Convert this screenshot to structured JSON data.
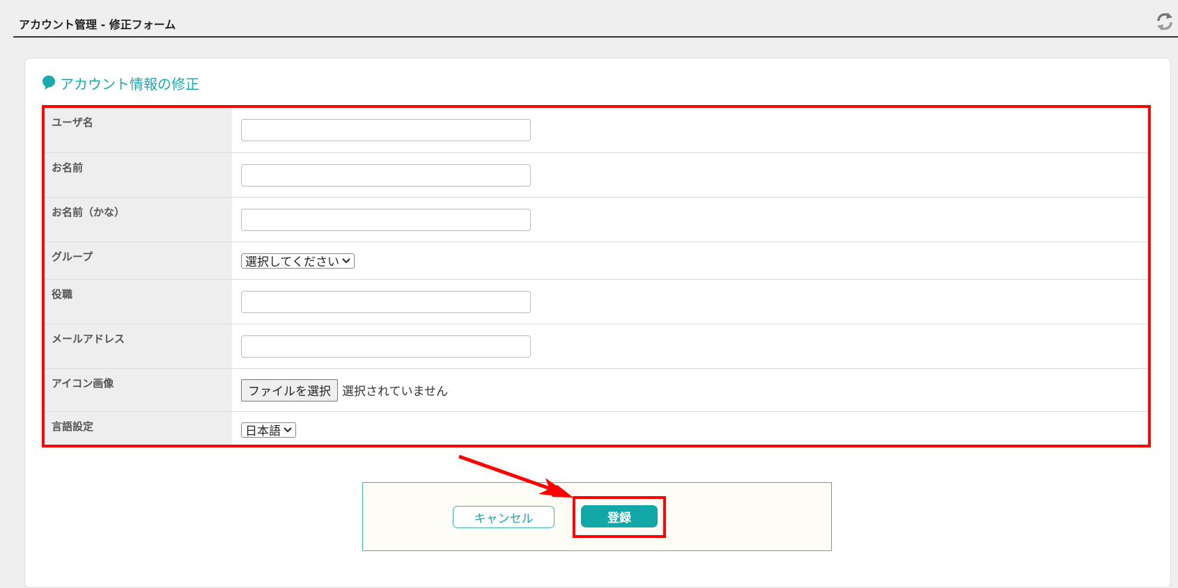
{
  "header": {
    "title": "アカウント管理 - 修正フォーム",
    "refresh_icon": "refresh-icon"
  },
  "section": {
    "title": "アカウント情報の修正"
  },
  "form": {
    "rows": [
      {
        "label": "ユーザ名",
        "type": "text",
        "value": ""
      },
      {
        "label": "お名前",
        "type": "text",
        "value": ""
      },
      {
        "label": "お名前（かな）",
        "type": "text",
        "value": ""
      },
      {
        "label": "グループ",
        "type": "select",
        "selected": "選択してください"
      },
      {
        "label": "役職",
        "type": "text",
        "value": ""
      },
      {
        "label": "メールアドレス",
        "type": "text",
        "value": ""
      },
      {
        "label": "アイコン画像",
        "type": "file",
        "button_label": "ファイルを選択",
        "status": "選択されていません"
      },
      {
        "label": "言語設定",
        "type": "select",
        "selected": "日本語"
      }
    ]
  },
  "actions": {
    "cancel_label": "キャンセル",
    "submit_label": "登録"
  },
  "colors": {
    "accent": "#1aa9ad",
    "highlight": "#ff0000",
    "submit_bg": "#12a8a8"
  }
}
